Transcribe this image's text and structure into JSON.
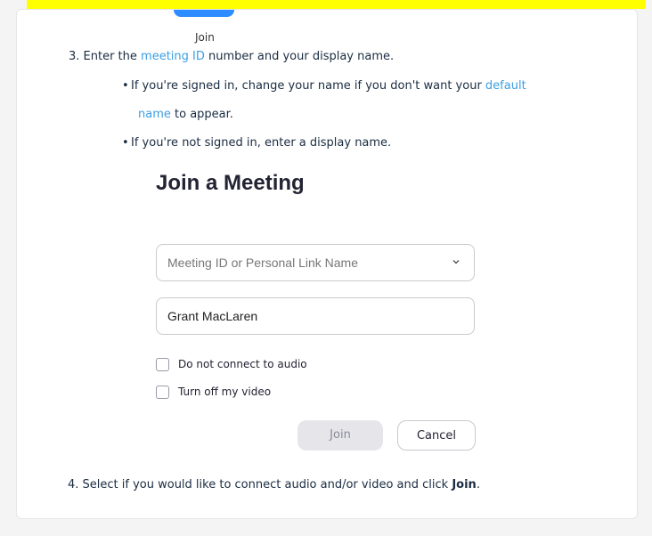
{
  "top": {
    "join_label": "Join"
  },
  "steps": {
    "step3": {
      "prefix": "3. Enter the ",
      "link": "meeting ID",
      "suffix": " number and your display name."
    },
    "bullet1": {
      "prefix": "If you're signed in, change your name if you don't want your ",
      "link1": "default",
      "link2": "name",
      "suffix": " to appear."
    },
    "bullet2": "If you're not signed in, enter a display name.",
    "step4": {
      "prefix": "4. Select if you would like to connect audio and/or video and click ",
      "bold": "Join",
      "suffix": "."
    }
  },
  "dialog": {
    "title": "Join a Meeting",
    "meeting_id_placeholder": "Meeting ID or Personal Link Name",
    "display_name_value": "Grant MacLaren",
    "checkbox_audio_label": "Do not connect to audio",
    "checkbox_video_label": "Turn off my video",
    "join_button_label": "Join",
    "cancel_button_label": "Cancel"
  },
  "colors": {
    "highlight": "#ffff00",
    "link": "#3a9fe3",
    "accent": "#2d8cff"
  }
}
